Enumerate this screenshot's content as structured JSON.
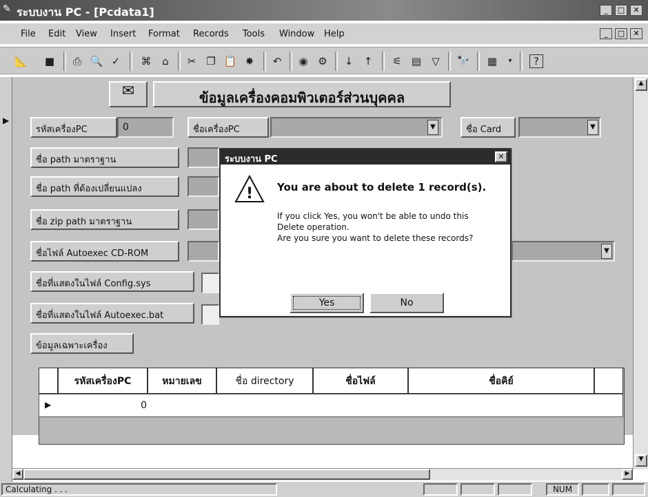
{
  "window": {
    "title": "ระบบงาน PC - [Pcdata1]",
    "controls": [
      "_",
      "□",
      "✕"
    ]
  },
  "menu": [
    "File",
    "Edit",
    "View",
    "Insert",
    "Format",
    "Records",
    "Tools",
    "Window",
    "Help"
  ],
  "mdi_controls": [
    "_",
    "□",
    "✕"
  ],
  "toolbar_icons": [
    "design-view-icon",
    "save-icon",
    "print-icon",
    "print-preview-icon",
    "spelling-icon",
    "format-painter-icon",
    "insert-hyperlink-icon",
    "cut-icon",
    "copy-icon",
    "paste-icon",
    "undo-icon",
    "sort-ascending-icon",
    "sort-descending-icon",
    "filter-by-selection-icon",
    "filter-by-form-icon",
    "apply-filter-icon",
    "find-icon",
    "new-object-icon",
    "help-icon"
  ],
  "form": {
    "title": "ข้อมูลเครื่องคอมพิวเตอร์ส่วนบุคคล",
    "fields": {
      "pc_id_label": "รหัสเครื่องPC",
      "pc_id_value": "0",
      "pc_name_label": "ชื่อเครื่องPC",
      "card_label": "ชื่อ Card",
      "std_path_label": "ชื่อ path มาตราฐาน",
      "change_path_label": "ชื่อ path ที่ต้องเปลี่ยนแปลง",
      "zip_path_label": "ชื่อ zip path มาตราฐาน",
      "autoexec_cdrom_label": "ชื่อไฟล์ Autoexec CD-ROM",
      "config_sys_label": "ชื่อที่แสดงในไฟล์ Config.sys",
      "autoexec_bat_label": "ชื่อที่แสดงในไฟล์ Autoexec.bat",
      "specific_info_label": "ข้อมูลเฉพาะเครื่อง"
    },
    "grid": {
      "headers": [
        "รหัสเครื่องPC",
        "หมายเลข",
        "ชื่อ directory",
        "ชื่อไฟล์",
        "ชื่อคิย์"
      ],
      "rows": [
        [
          "0",
          "",
          "",
          "",
          ""
        ]
      ]
    }
  },
  "dialog": {
    "title": "ระบบงาน PC",
    "icon": "exclamation-icon",
    "message": "You are about to delete 1 record(s).",
    "detail1": "If you click Yes, you won't be able to undo this",
    "detail2": "Delete operation.",
    "question": "Are you sure you want to delete these records?",
    "yes": "Yes",
    "no": "No"
  },
  "status": {
    "text": "Calculating . . .",
    "num": "NUM"
  }
}
